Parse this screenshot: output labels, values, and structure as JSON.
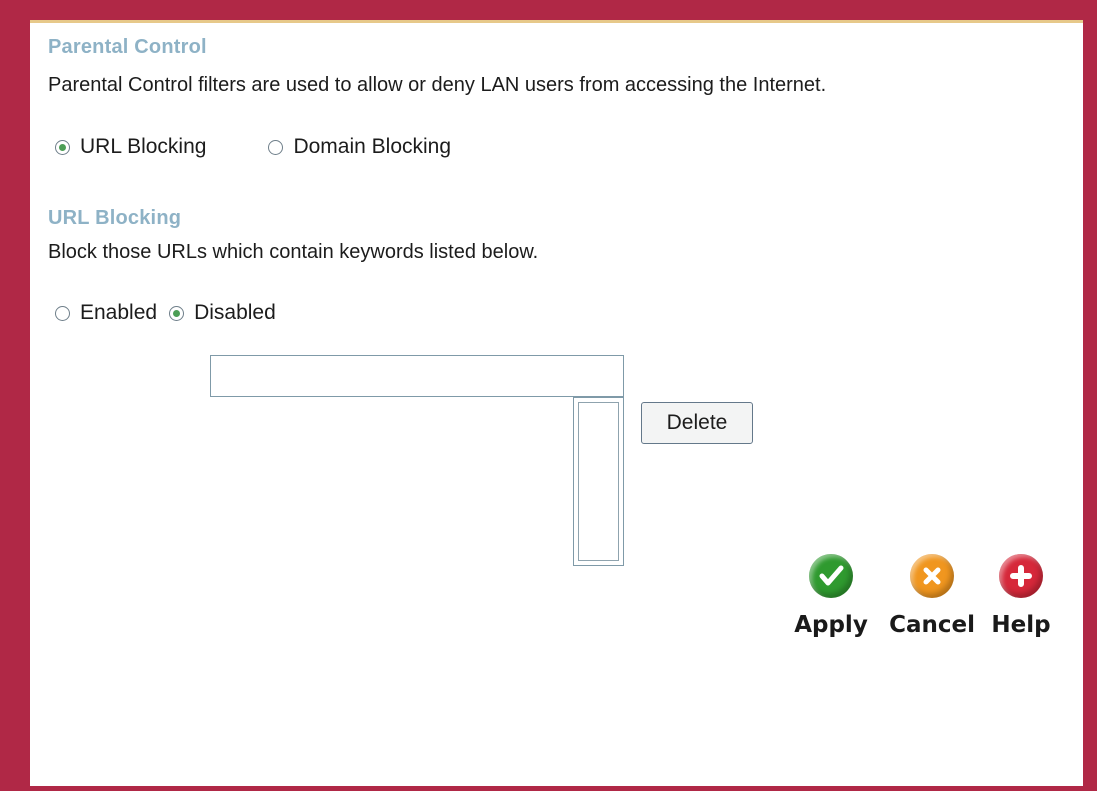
{
  "section": {
    "title": "Parental Control",
    "description": "Parental Control filters are used to allow or deny LAN users from accessing the Internet.",
    "modes": [
      {
        "label": "URL Blocking",
        "selected": true
      },
      {
        "label": "Domain Blocking",
        "selected": false
      }
    ]
  },
  "url_blocking": {
    "title": "URL Blocking",
    "description": "Block those URLs which contain keywords listed below.",
    "state_options": [
      {
        "label": "Enabled",
        "selected": false
      },
      {
        "label": "Disabled",
        "selected": true
      }
    ],
    "keyword_input": {
      "value": "",
      "placeholder": ""
    },
    "keyword_list": [],
    "delete_label": "Delete"
  },
  "actions": {
    "apply": {
      "label": "Apply",
      "icon": "checkmark-icon",
      "color": "#2f9a2f"
    },
    "cancel": {
      "label": "Cancel",
      "icon": "x-icon",
      "color": "#f0961f"
    },
    "help": {
      "label": "Help",
      "icon": "plus-icon",
      "color": "#d6283a"
    }
  },
  "colors": {
    "frame": "#b02846",
    "heading": "#8eb2c6"
  }
}
